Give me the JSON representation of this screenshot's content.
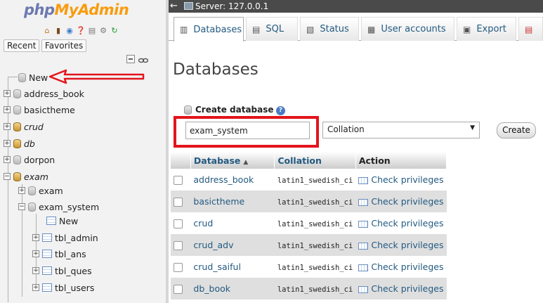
{
  "nav": {
    "logo": {
      "php": "php",
      "my": "My",
      "admin": "Admin"
    },
    "icons": [
      "home-icon",
      "exit-icon",
      "docs-icon",
      "help-icon",
      "copy-icon",
      "gear-icon",
      "reload-icon"
    ],
    "tabs": {
      "recent": "Recent",
      "favorites": "Favorites"
    },
    "tree": [
      {
        "label": "New"
      },
      {
        "label": "address_book"
      },
      {
        "label": "basictheme"
      },
      {
        "label": "crud"
      },
      {
        "label": "db"
      },
      {
        "label": "dorpon"
      },
      {
        "label": "exam"
      },
      {
        "label": "exam"
      },
      {
        "label": "exam_system"
      },
      {
        "label": "New"
      },
      {
        "label": "tbl_admin"
      },
      {
        "label": "tbl_ans"
      },
      {
        "label": "tbl_ques"
      },
      {
        "label": "tbl_users"
      }
    ]
  },
  "topbar": {
    "server": "Server: 127.0.0.1"
  },
  "tabs": [
    {
      "label": "Databases"
    },
    {
      "label": "SQL"
    },
    {
      "label": "Status"
    },
    {
      "label": "User accounts"
    },
    {
      "label": "Export"
    }
  ],
  "main": {
    "title": "Databases",
    "create_label": "Create database",
    "db_name_value": "exam_system",
    "collation_selected": "Collation",
    "create_button": "Create",
    "table": {
      "headers": {
        "database": "Database",
        "collation": "Collation",
        "action": "Action"
      },
      "rows": [
        {
          "name": "address_book",
          "collation": "latin1_swedish_ci",
          "action": "Check privileges"
        },
        {
          "name": "basictheme",
          "collation": "latin1_swedish_ci",
          "action": "Check privileges"
        },
        {
          "name": "crud",
          "collation": "latin1_swedish_ci",
          "action": "Check privileges"
        },
        {
          "name": "crud_adv",
          "collation": "latin1_swedish_ci",
          "action": "Check privileges"
        },
        {
          "name": "crud_saiful",
          "collation": "latin1_swedish_ci",
          "action": "Check privileges"
        },
        {
          "name": "db_book",
          "collation": "latin1_swedish_ci",
          "action": "Check privileges"
        }
      ]
    }
  },
  "colors": {
    "accent": "#235a81",
    "highlight": "#e3141c"
  }
}
